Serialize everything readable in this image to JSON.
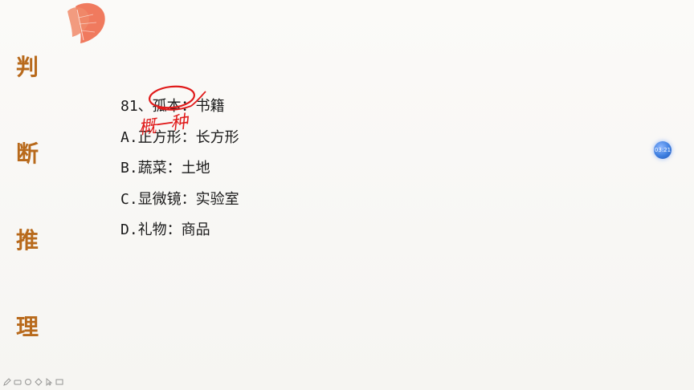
{
  "side_title": [
    "判",
    "断",
    "推",
    "理"
  ],
  "question": {
    "stem": "81、孤本：书籍",
    "options": [
      "A.正方形：长方形",
      "B.蔬菜：土地",
      "C.显微镜：实验室",
      "D.礼物：商品"
    ]
  },
  "annotation_text": "概一种",
  "timer": "03:21",
  "colors": {
    "side_title": "#b86a1c",
    "annotation": "#e01a1a",
    "leaf": "#e9563d",
    "timer": "#3e7fe0"
  },
  "toolbar_icons": [
    "pen-icon",
    "eraser-icon",
    "highlighter-icon",
    "shape-icon",
    "pointer-icon",
    "screen-icon"
  ]
}
